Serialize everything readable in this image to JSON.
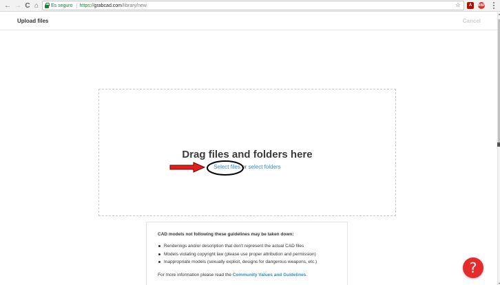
{
  "browser": {
    "secure_label": "Es seguro",
    "url_scheme": "https://",
    "url_host": "grabcad.com",
    "url_path": "/library/new",
    "back_glyph": "←",
    "forward_glyph": "→",
    "reload_glyph": "C",
    "home_glyph": "⌂",
    "star_glyph": "☆",
    "ext_pdf_glyph": "A",
    "ext_abp_glyph": "ABP"
  },
  "header": {
    "title": "Upload files",
    "cancel_label": "Cancel"
  },
  "dropzone": {
    "title": "Drag files and folders here",
    "select_files_label": "Select files",
    "connector_text": " or ",
    "select_folders_label": "select folders"
  },
  "guidelines": {
    "heading": "CAD models not following these guidelines may be taken down:",
    "items": [
      "Renderings and/or description that don't represent the actual CAD files",
      "Models violating copyright law (please use proper attribution and permission)",
      "Inappropriate models (sexually explicit, designs for dangerous weapons, etc.)"
    ],
    "more_prefix": "For more information please read the ",
    "more_link": "Community Values and Guidelines",
    "more_suffix": "."
  },
  "help": {
    "glyph": "?"
  },
  "colors": {
    "accent_link": "#2b8dc6",
    "annotation_red": "#e0201b",
    "help_red": "#e32c2b"
  },
  "icons": [
    "back-arrow-icon",
    "forward-arrow-icon",
    "reload-icon",
    "home-icon",
    "lock-icon",
    "star-icon",
    "pdf-extension-icon",
    "adblock-extension-icon",
    "menu-dots-icon",
    "help-icon"
  ]
}
